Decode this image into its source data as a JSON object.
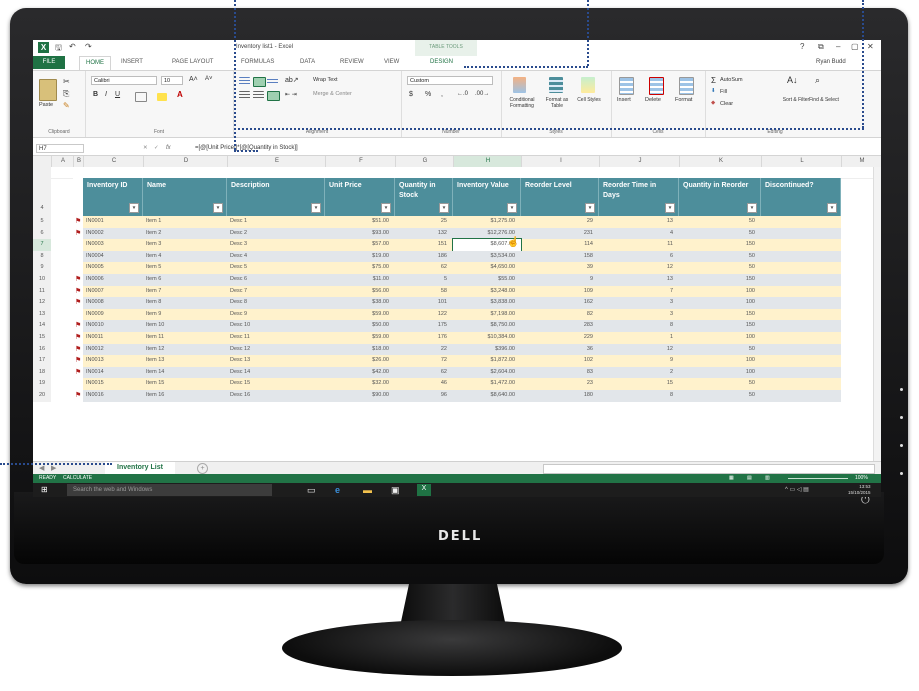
{
  "window": {
    "title": "Inventory list1 - Excel",
    "table_tools": "TABLE TOOLS",
    "user": "Ryan Budd",
    "controls": [
      "?",
      "⧉",
      "–",
      "▢",
      "✕"
    ]
  },
  "tabs": {
    "file": "FILE",
    "home": "HOME",
    "insert": "INSERT",
    "page_layout": "PAGE LAYOUT",
    "formulas": "FORMULAS",
    "data": "DATA",
    "review": "REVIEW",
    "view": "VIEW",
    "design": "DESIGN"
  },
  "ribbon": {
    "clipboard": {
      "label": "Clipboard",
      "paste": "Paste"
    },
    "font": {
      "label": "Font",
      "name": "Calibri",
      "size": "10",
      "bold": "B",
      "italic": "I",
      "underline": "U"
    },
    "alignment": {
      "label": "Alignment",
      "wrap_text": "Wrap Text",
      "merge_center": "Merge & Center"
    },
    "number": {
      "label": "Number",
      "format": "Custom",
      "currency": "$",
      "percent": "%",
      "comma": ","
    },
    "styles": {
      "label": "Styles",
      "conditional": "Conditional Formatting",
      "format_table": "Format as Table",
      "cell_styles": "Cell Styles"
    },
    "cells": {
      "label": "Cells",
      "insert": "Insert",
      "delete": "Delete",
      "format": "Format"
    },
    "editing": {
      "label": "Editing",
      "autosum": "AutoSum",
      "fill": "Fill",
      "clear": "Clear",
      "sort_filter": "Sort & Filter",
      "find_select": "Find & Select"
    }
  },
  "formula_bar": {
    "name_box": "H7",
    "fx": "fx",
    "formula": "=[@[Unit Price]]*[@[Quantity in Stock]]"
  },
  "columns": [
    "A",
    "B",
    "C",
    "D",
    "E",
    "F",
    "G",
    "H",
    "I",
    "J",
    "K",
    "L",
    "M"
  ],
  "table": {
    "headers": [
      "Inventory ID",
      "Name",
      "Description",
      "Unit Price",
      "Quantity in Stock",
      "Inventory Value",
      "Reorder Level",
      "Reorder Time in Days",
      "Quantity in Reorder",
      "Discontinued?"
    ],
    "rows": [
      {
        "row": "5",
        "flag": true,
        "id": "IN0001",
        "name": "Item 1",
        "desc": "Desc 1",
        "price": "$51.00",
        "qty": "25",
        "value": "$1,275.00",
        "reorder": "29",
        "days": "13",
        "qreorder": "50"
      },
      {
        "row": "6",
        "flag": true,
        "id": "IN0002",
        "name": "Item 2",
        "desc": "Desc 2",
        "price": "$93.00",
        "qty": "132",
        "value": "$12,276.00",
        "reorder": "231",
        "days": "4",
        "qreorder": "50"
      },
      {
        "row": "7",
        "flag": false,
        "id": "IN0003",
        "name": "Item 3",
        "desc": "Desc 3",
        "price": "$57.00",
        "qty": "151",
        "value": "$8,607.00",
        "reorder": "114",
        "days": "11",
        "qreorder": "150"
      },
      {
        "row": "8",
        "flag": false,
        "id": "IN0004",
        "name": "Item 4",
        "desc": "Desc 4",
        "price": "$19.00",
        "qty": "186",
        "value": "$3,534.00",
        "reorder": "158",
        "days": "6",
        "qreorder": "50"
      },
      {
        "row": "9",
        "flag": false,
        "id": "IN0005",
        "name": "Item 5",
        "desc": "Desc 5",
        "price": "$75.00",
        "qty": "62",
        "value": "$4,650.00",
        "reorder": "39",
        "days": "12",
        "qreorder": "50"
      },
      {
        "row": "10",
        "flag": true,
        "id": "IN0006",
        "name": "Item 6",
        "desc": "Desc 6",
        "price": "$11.00",
        "qty": "5",
        "value": "$55.00",
        "reorder": "9",
        "days": "13",
        "qreorder": "150"
      },
      {
        "row": "11",
        "flag": true,
        "id": "IN0007",
        "name": "Item 7",
        "desc": "Desc 7",
        "price": "$56.00",
        "qty": "58",
        "value": "$3,248.00",
        "reorder": "109",
        "days": "7",
        "qreorder": "100"
      },
      {
        "row": "12",
        "flag": true,
        "id": "IN0008",
        "name": "Item 8",
        "desc": "Desc 8",
        "price": "$38.00",
        "qty": "101",
        "value": "$3,838.00",
        "reorder": "162",
        "days": "3",
        "qreorder": "100"
      },
      {
        "row": "13",
        "flag": false,
        "id": "IN0009",
        "name": "Item 9",
        "desc": "Desc 9",
        "price": "$59.00",
        "qty": "122",
        "value": "$7,198.00",
        "reorder": "82",
        "days": "3",
        "qreorder": "150"
      },
      {
        "row": "14",
        "flag": true,
        "id": "IN0010",
        "name": "Item 10",
        "desc": "Desc 10",
        "price": "$50.00",
        "qty": "175",
        "value": "$8,750.00",
        "reorder": "283",
        "days": "8",
        "qreorder": "150"
      },
      {
        "row": "15",
        "flag": true,
        "id": "IN0011",
        "name": "Item 11",
        "desc": "Desc 11",
        "price": "$59.00",
        "qty": "176",
        "value": "$10,384.00",
        "reorder": "229",
        "days": "1",
        "qreorder": "100"
      },
      {
        "row": "16",
        "flag": true,
        "id": "IN0012",
        "name": "Item 12",
        "desc": "Desc 12",
        "price": "$18.00",
        "qty": "22",
        "value": "$396.00",
        "reorder": "36",
        "days": "12",
        "qreorder": "50"
      },
      {
        "row": "17",
        "flag": true,
        "id": "IN0013",
        "name": "Item 13",
        "desc": "Desc 13",
        "price": "$26.00",
        "qty": "72",
        "value": "$1,872.00",
        "reorder": "102",
        "days": "9",
        "qreorder": "100"
      },
      {
        "row": "18",
        "flag": true,
        "id": "IN0014",
        "name": "Item 14",
        "desc": "Desc 14",
        "price": "$42.00",
        "qty": "62",
        "value": "$2,604.00",
        "reorder": "83",
        "days": "2",
        "qreorder": "100"
      },
      {
        "row": "19",
        "flag": false,
        "id": "IN0015",
        "name": "Item 15",
        "desc": "Desc 15",
        "price": "$32.00",
        "qty": "46",
        "value": "$1,472.00",
        "reorder": "23",
        "days": "15",
        "qreorder": "50"
      },
      {
        "row": "20",
        "flag": true,
        "id": "IN0016",
        "name": "Item 16",
        "desc": "Desc 16",
        "price": "$90.00",
        "qty": "96",
        "value": "$8,640.00",
        "reorder": "180",
        "days": "8",
        "qreorder": "50"
      }
    ]
  },
  "sheet_tab": "Inventory List",
  "status": {
    "ready": "READY",
    "calculate": "CALCULATE",
    "zoom": "100%"
  },
  "taskbar": {
    "search_placeholder": "Search the web and Windows",
    "time": "13:53",
    "date": "15/10/2015"
  },
  "brand": "DELL",
  "colors": {
    "header_teal": "#4d8e9b",
    "row_yellow": "#fff2cc",
    "row_grey": "#e2e6ea",
    "excel_green": "#217346",
    "flag_red": "#b01c1c"
  }
}
